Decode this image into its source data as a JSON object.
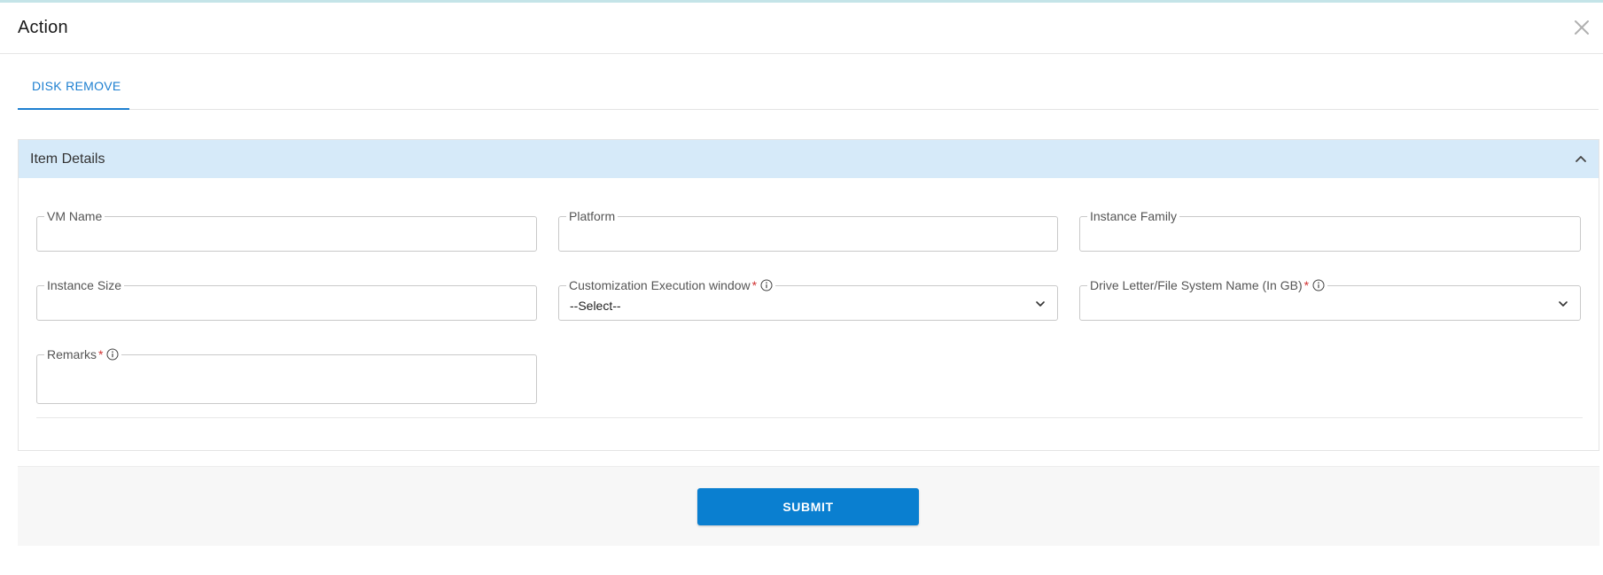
{
  "dialog": {
    "title": "Action",
    "close_icon": "close-icon"
  },
  "tabs": [
    {
      "label": "DISK REMOVE",
      "active": true
    }
  ],
  "panel": {
    "title": "Item Details",
    "collapse_icon": "chevron-up-icon",
    "fields": {
      "vm_name": {
        "label": "VM Name",
        "value": ""
      },
      "platform": {
        "label": "Platform",
        "value": ""
      },
      "instance_family": {
        "label": "Instance Family",
        "value": ""
      },
      "instance_size": {
        "label": "Instance Size",
        "value": ""
      },
      "customization_window": {
        "label": "Customization Execution window",
        "required": "*",
        "value": "--Select--",
        "info_icon": "info-icon",
        "caret_icon": "chevron-down-icon"
      },
      "drive_letter": {
        "label": "Drive Letter/File System Name (In GB)",
        "required": "*",
        "value": "",
        "info_icon": "info-icon",
        "caret_icon": "chevron-down-icon"
      },
      "remarks": {
        "label": "Remarks",
        "required": "*",
        "value": "",
        "info_icon": "info-icon"
      }
    }
  },
  "footer": {
    "submit_label": "SUBMIT"
  },
  "colors": {
    "accent": "#1d7fd0",
    "button": "#0a7fd0",
    "panel_header": "#d6eaf9",
    "required": "#d03030"
  }
}
